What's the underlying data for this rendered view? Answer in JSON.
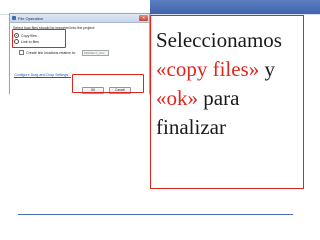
{
  "dialog": {
    "title": "File Operation",
    "close_glyph": "✕",
    "instruction": "Select how files should be imported into the project:",
    "options": [
      {
        "label": "Copy files",
        "selected": true
      },
      {
        "label": "Link to files",
        "selected": false
      }
    ],
    "checkbox_label": "Create link locations relative to:",
    "relative_to": "PROJECT_LOC",
    "configure_link": "Configure Drag and Drop Settings...",
    "ok_label": "OK",
    "cancel_label": "Cancel"
  },
  "slide": {
    "line1": "Seleccionamos",
    "quote1": "«copy files»",
    "word_y": "y",
    "quote2": "«ok»",
    "word_para": "para",
    "line4": "finalizar"
  },
  "colors": {
    "accent": "#e0261b",
    "header_blue": "#4a6db8"
  }
}
